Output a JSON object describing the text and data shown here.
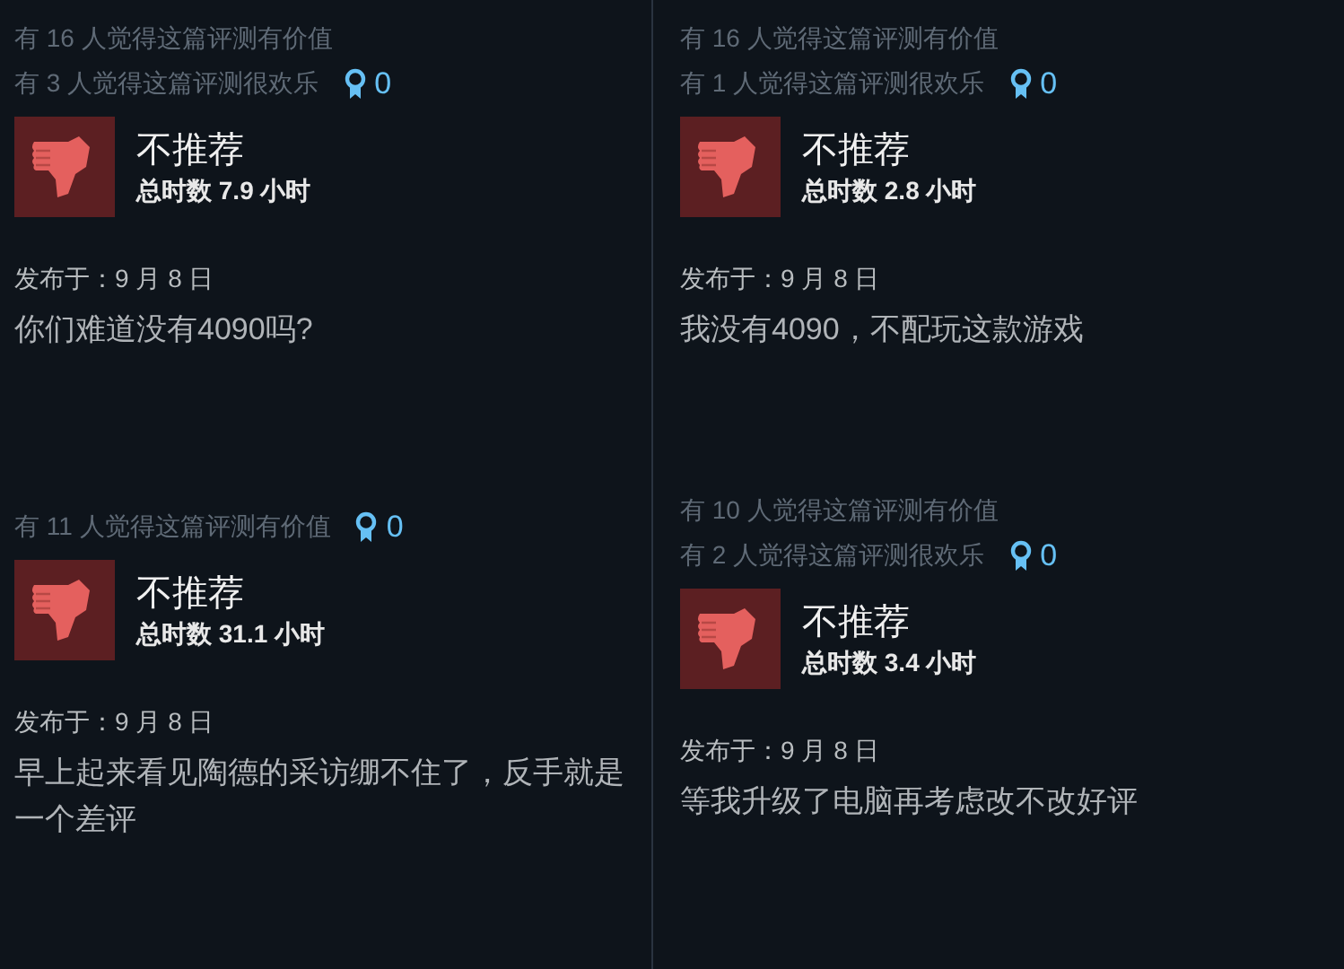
{
  "columns": [
    {
      "reviews": [
        {
          "helpful": [
            "有 16 人觉得这篇评测有价值",
            "有 3 人觉得这篇评测很欢乐"
          ],
          "awards": "0",
          "recommendation": "不推荐",
          "recommended": false,
          "hours": "总时数 7.9 小时",
          "date": "发布于：9 月 8 日",
          "body": "你们难道没有4090吗?"
        },
        {
          "helpful": [
            "有 11 人觉得这篇评测有价值"
          ],
          "awards": "0",
          "recommendation": "不推荐",
          "recommended": false,
          "hours": "总时数 31.1 小时",
          "date": "发布于：9 月 8 日",
          "body": "早上起来看见陶德的采访绷不住了，反手就是一个差评"
        }
      ]
    },
    {
      "reviews": [
        {
          "helpful": [
            "有 16 人觉得这篇评测有价值",
            "有 1 人觉得这篇评测很欢乐"
          ],
          "awards": "0",
          "recommendation": "不推荐",
          "recommended": false,
          "hours": "总时数 2.8 小时",
          "date": "发布于：9 月 8 日",
          "body": "我没有4090，不配玩这款游戏"
        },
        {
          "helpful": [
            "有 10 人觉得这篇评测有价值",
            "有 2 人觉得这篇评测很欢乐"
          ],
          "awards": "0",
          "recommendation": "不推荐",
          "recommended": false,
          "hours": "总时数 3.4 小时",
          "date": "发布于：9 月 8 日",
          "body": "等我升级了电脑再考虑改不改好评"
        }
      ]
    }
  ]
}
